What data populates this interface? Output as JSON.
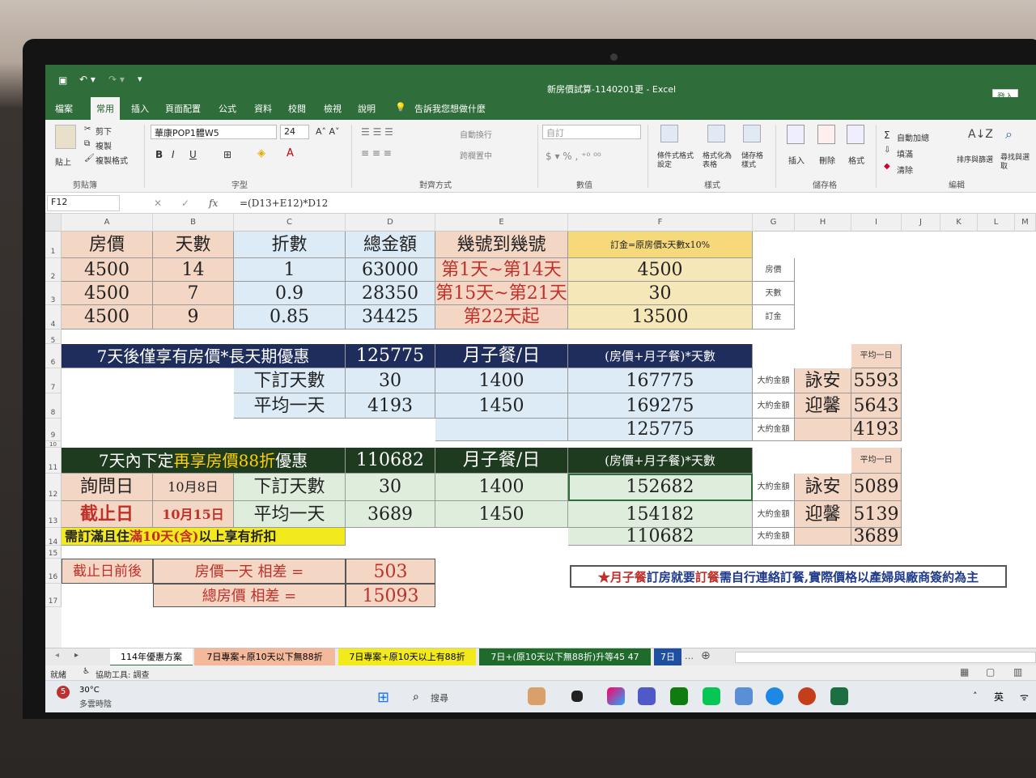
{
  "window": {
    "title": "新房價試算-1140201更  -  Excel",
    "signin": "登入"
  },
  "ribbon": {
    "tabs": [
      "檔案",
      "常用",
      "插入",
      "頁面配置",
      "公式",
      "資料",
      "校閱",
      "檢視",
      "說明"
    ],
    "tell_me": "告訴我您想做什麼",
    "clipboard": {
      "paste": "貼上",
      "cut": "剪下",
      "copy": "複製",
      "format_painter": "複製格式",
      "group": "剪貼簿"
    },
    "font": {
      "name": "華康POP1體W5",
      "size": "24",
      "group": "字型"
    },
    "alignment": {
      "wrap": "自動換行",
      "merge": "跨欄置中",
      "group": "對齊方式"
    },
    "number": {
      "format": "自訂",
      "group": "數值"
    },
    "styles": {
      "conditional": "條件式格式設定",
      "format_table": "格式化為表格",
      "cell_styles": "儲存格樣式",
      "group": "樣式"
    },
    "cells": {
      "insert": "插入",
      "delete": "刪除",
      "format": "格式",
      "group": "儲存格"
    },
    "editing": {
      "autosum": "自動加總",
      "fill": "填滿",
      "clear": "清除",
      "sort_filter": "排序與篩選",
      "find_select": "尋找與選取",
      "group": "編輯"
    }
  },
  "formula_bar": {
    "name_box": "F12",
    "fx": "fx",
    "formula": "=(D13+E12)*D12"
  },
  "columns": [
    "A",
    "B",
    "C",
    "D",
    "E",
    "F",
    "G",
    "H",
    "I",
    "J",
    "K",
    "L",
    "M"
  ],
  "rows": [
    "1",
    "2",
    "3",
    "4",
    "5",
    "6",
    "7",
    "8",
    "9",
    "10",
    "11",
    "12",
    "13",
    "14",
    "15",
    "16",
    "17"
  ],
  "cells": {
    "A1": "房價",
    "B1": "天數",
    "C1": "折數",
    "D1": "總金額",
    "E1": "幾號到幾號",
    "F1": "訂金=原房價x天數x10%",
    "A2": "4500",
    "B2": "14",
    "C2": "1",
    "D2": "63000",
    "E2": "第1天~第14天",
    "F2": "4500",
    "G2": "房價",
    "A3": "4500",
    "B3": "7",
    "C3": "0.9",
    "D3": "28350",
    "E3": "第15天~第21天",
    "F3": "30",
    "G3": "天數",
    "A4": "4500",
    "B4": "9",
    "C4": "0.85",
    "D4": "34425",
    "E4": "第22天起",
    "F4": "13500",
    "G4": "訂金",
    "A6": "7天後僅享有房價*長天期優惠",
    "D6": "125775",
    "E6": "月子餐/日",
    "F6": "(房價+月子餐)*天數",
    "I6": "平均一日",
    "C7": "下訂天數",
    "D7": "30",
    "E7": "1400",
    "F7": "167775",
    "G7": "大約金額",
    "H7": "詠安",
    "I7": "5593",
    "C8": "平均一天",
    "D8": "4193",
    "E8": "1450",
    "F8": "169275",
    "G8": "大約金額",
    "H8": "迎馨",
    "I8": "5643",
    "F9": "125775",
    "G9": "大約金額",
    "I9": "4193",
    "A11_pre": "7天內下定",
    "A11_red": "再享房價88折",
    "A11_post": "優惠",
    "D11": "110682",
    "E11": "月子餐/日",
    "F11": "(房價+月子餐)*天數",
    "I10": "平均一日",
    "A12": "詢問日",
    "B12": "10月8日",
    "C12": "下訂天數",
    "D12": "30",
    "E12": "1400",
    "F12": "152682",
    "G12": "大約金額",
    "H12": "詠安",
    "I12": "5089",
    "A13": "截止日",
    "B13": "10月15日",
    "C13": "平均一天",
    "D13": "3689",
    "E13": "1450",
    "F13": "154182",
    "G13": "大約金額",
    "H13": "迎馨",
    "I13": "5139",
    "A14_pre": "需訂滿且住",
    "A14_red": "滿10天(含)",
    "A14_post": "以上享有折扣",
    "F14": "110682",
    "G14": "大約金額",
    "I14": "3689",
    "A16": "截止日前後",
    "B16": "房價一天  相差    =",
    "D16": "503",
    "B17": "總房價  相差    =",
    "D17": "15093",
    "F16_star": "★",
    "F16_red1": "月子餐",
    "F16_blue1": "訂房就要",
    "F16_red2": "訂餐",
    "F16_blue2": "需自行連絡訂餐,實際價格以產婦與廠商簽約為主"
  },
  "sheet_tabs": [
    "114年優惠方案",
    "7日專案+原10天以下無88折",
    "7日專案+原10天以上有88折",
    "7日+(原10天以下無88折)升等45 47",
    "7日"
  ],
  "status": {
    "ready": "就緒",
    "accessibility": "協助工具: 調查"
  },
  "taskbar": {
    "weather_temp": "30°C",
    "weather_desc": "多雲時陰",
    "weather_badge": "5",
    "search": "搜尋",
    "lang": "英"
  },
  "colors": {
    "title_green": "#2f6d3a",
    "navy_band": "#1f2d5c",
    "green_band": "#1e3b1f",
    "gold": "#f5d97a",
    "yellow": "#f2ea1c",
    "peach": "#f4d6c4",
    "lightblue": "#dcebf5",
    "lightgreen": "#dfeedc",
    "red_text": "#c0302a",
    "blue_text": "#1f3a8a"
  }
}
